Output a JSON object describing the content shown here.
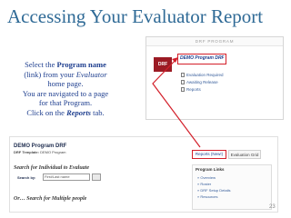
{
  "slide": {
    "title": "Accessing Your Evaluator Report",
    "page_number": "23"
  },
  "callout": {
    "line1_pre": "Select the ",
    "line1_bold": "Program name",
    "line2_pre": "(link) from your ",
    "line2_ital": "Evaluator",
    "line3": "home page.",
    "line4": "You are navigated to a page",
    "line5": "for that Program.",
    "line6_pre": "Click on the ",
    "line6_bold": "Reports",
    "line6_post": " tab."
  },
  "drf_panel": {
    "header": "DRF PROGRAM",
    "badge": "DRF",
    "program_link": "DEMO Program DRF",
    "items": [
      "Evaluation Required",
      "Awaiting Release",
      "Reports"
    ]
  },
  "program_page": {
    "title": "DEMO Program DRF",
    "template_label": "DRF Template:",
    "template_value": "DEMO Program",
    "search_individual": "Search for Individual to Evaluate",
    "search_by_label": "Search by:",
    "search_value": "First/Last name",
    "or_multiple": "Or… Search for Multiple people",
    "tabs": {
      "reports": "Reports (New!)",
      "grid": "Evaluation Grid"
    },
    "links_header": "Program Links",
    "links": [
      "Overview",
      "Roster",
      "DRF Setup Details",
      "Resources"
    ]
  }
}
